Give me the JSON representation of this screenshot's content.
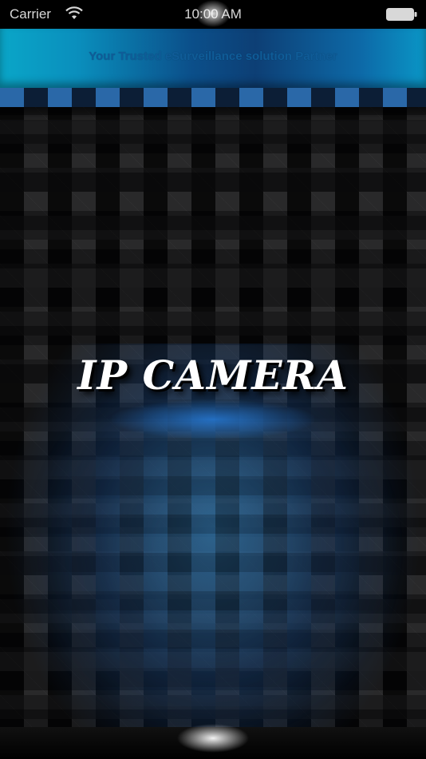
{
  "status_bar": {
    "carrier": "Carrier",
    "time": "10:00 AM",
    "wifi_icon": "wifi-icon",
    "battery_icon": "battery-icon"
  },
  "banner": {
    "tagline": "Your Trusted eSurveillance solution Partner"
  },
  "splash": {
    "title": "IP CAMERA"
  },
  "colors": {
    "banner_accent": "#0a8fbd",
    "tile_blue": "#2a68a8",
    "background": "#0d0d0e"
  }
}
